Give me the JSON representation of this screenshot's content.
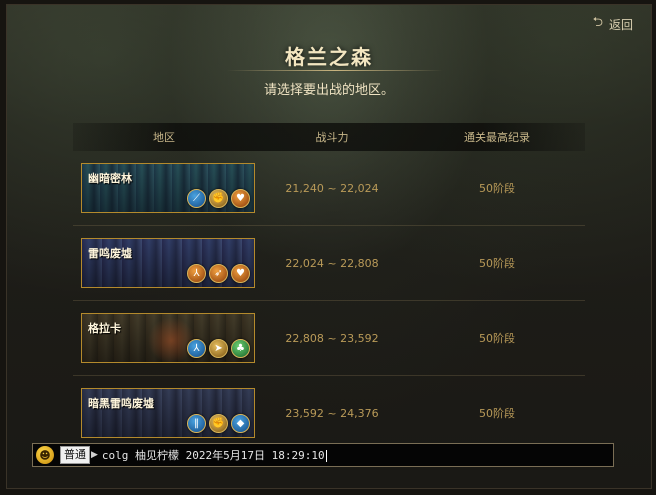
{
  "header": {
    "back_label": "返回",
    "title": "格兰之森",
    "subtitle": "请选择要出战的地区。"
  },
  "table": {
    "columns": [
      "地区",
      "战斗力",
      "通关最高纪录"
    ],
    "rows": [
      {
        "name": "幽暗密林",
        "power": "21,240 ~ 22,024",
        "record": "50阶段",
        "icons": [
          "blue-slash-icon",
          "gold-fist-icon",
          "orange-heart-icon"
        ]
      },
      {
        "name": "雷鸣废墟",
        "power": "22,024 ~ 22,808",
        "record": "50阶段",
        "icons": [
          "orange-tri-icon",
          "orange-dash-icon",
          "orange-heart-icon"
        ]
      },
      {
        "name": "格拉卡",
        "power": "22,808 ~ 23,592",
        "record": "50阶段",
        "icons": [
          "blue-tri-icon",
          "gold-wing-icon",
          "green-clover-icon"
        ]
      },
      {
        "name": "暗黑雷鸣废墟",
        "power": "23,592 ~ 24,376",
        "record": "50阶段",
        "icons": [
          "blue-pillar-icon",
          "gold-fist-icon",
          "blue-diamond-icon"
        ]
      }
    ]
  },
  "chat": {
    "channel": "普通",
    "message": "colg 柚见柠檬 2022年5月17日 18:29:10"
  },
  "colors": {
    "accent_gold": "#b48a2c",
    "power_text": "#b99a58"
  }
}
